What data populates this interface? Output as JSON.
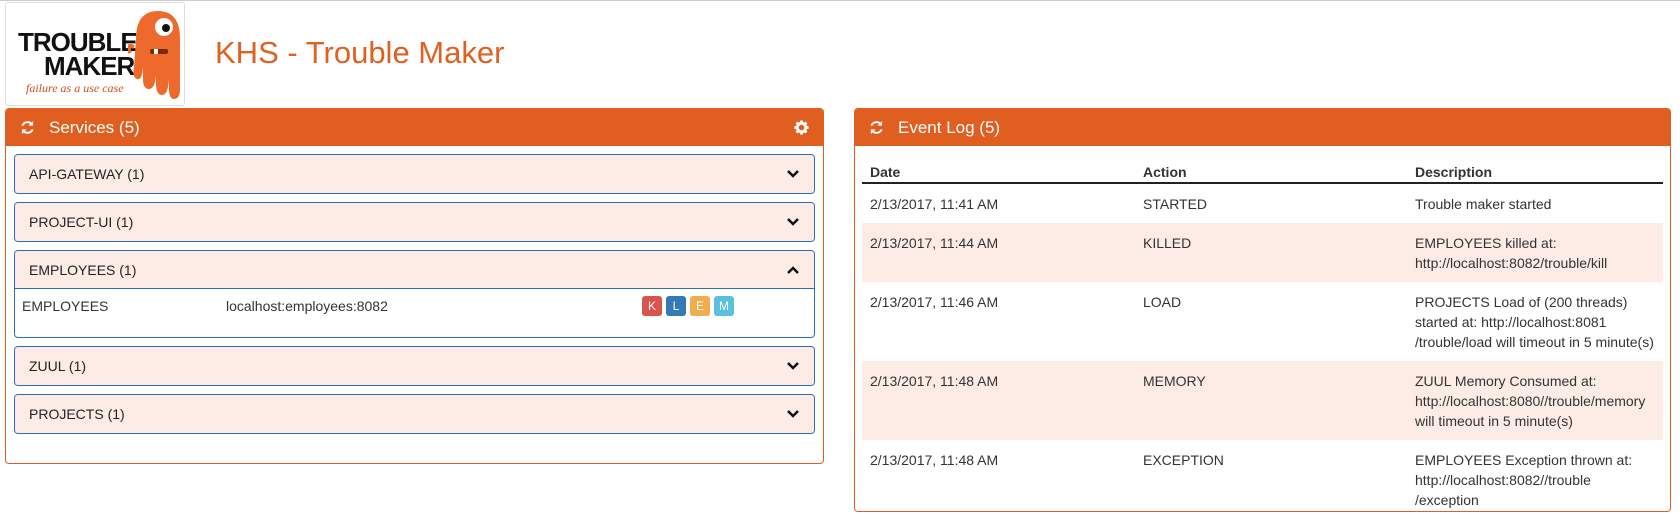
{
  "header": {
    "logo_line1": "TROUBLE",
    "logo_line2": "MAKER",
    "logo_tagline": "failure as a use case",
    "app_title": "KHS - Trouble Maker"
  },
  "colors": {
    "brand": "#e05e20",
    "row_alt": "#fdece6",
    "accent_blue": "#2a6fb5"
  },
  "services_panel": {
    "title": "Services (5)",
    "refresh_icon": "refresh-icon",
    "settings_icon": "gear-icon",
    "services": [
      {
        "label": "API-GATEWAY (1)",
        "expanded": false
      },
      {
        "label": "PROJECT-UI (1)",
        "expanded": false
      },
      {
        "label": "EMPLOYEES (1)",
        "expanded": true,
        "instance": {
          "name": "EMPLOYEES",
          "host": "localhost:employees:8082",
          "actions": [
            {
              "label": "K",
              "color": "#d9534f"
            },
            {
              "label": "L",
              "color": "#337ab7"
            },
            {
              "label": "E",
              "color": "#f0ad4e"
            },
            {
              "label": "M",
              "color": "#5bc0de"
            }
          ]
        }
      },
      {
        "label": "ZUUL (1)",
        "expanded": false
      },
      {
        "label": "PROJECTS (1)",
        "expanded": false
      }
    ]
  },
  "event_log": {
    "title": "Event Log (5)",
    "refresh_icon": "refresh-icon",
    "columns": [
      "Date",
      "Action",
      "Description"
    ],
    "rows": [
      {
        "date": "2/13/2017, 11:41 AM",
        "action": "STARTED",
        "description": [
          "Trouble maker started"
        ]
      },
      {
        "date": "2/13/2017, 11:44 AM",
        "action": "KILLED",
        "description": [
          "EMPLOYEES killed at:",
          "http://localhost:8082/trouble/kill"
        ]
      },
      {
        "date": "2/13/2017, 11:46 AM",
        "action": "LOAD",
        "description": [
          "PROJECTS Load of (200 threads)",
          "started at: http://localhost:8081",
          "/trouble/load will timeout in 5 minute(s)"
        ]
      },
      {
        "date": "2/13/2017, 11:48 AM",
        "action": "MEMORY",
        "description": [
          "ZUUL Memory Consumed at:",
          "http://localhost:8080//trouble/memory",
          "will timeout in 5 minute(s)"
        ]
      },
      {
        "date": "2/13/2017, 11:48 AM",
        "action": "EXCEPTION",
        "description": [
          "EMPLOYEES Exception thrown at:",
          "http://localhost:8082//trouble",
          "/exception"
        ]
      }
    ]
  }
}
